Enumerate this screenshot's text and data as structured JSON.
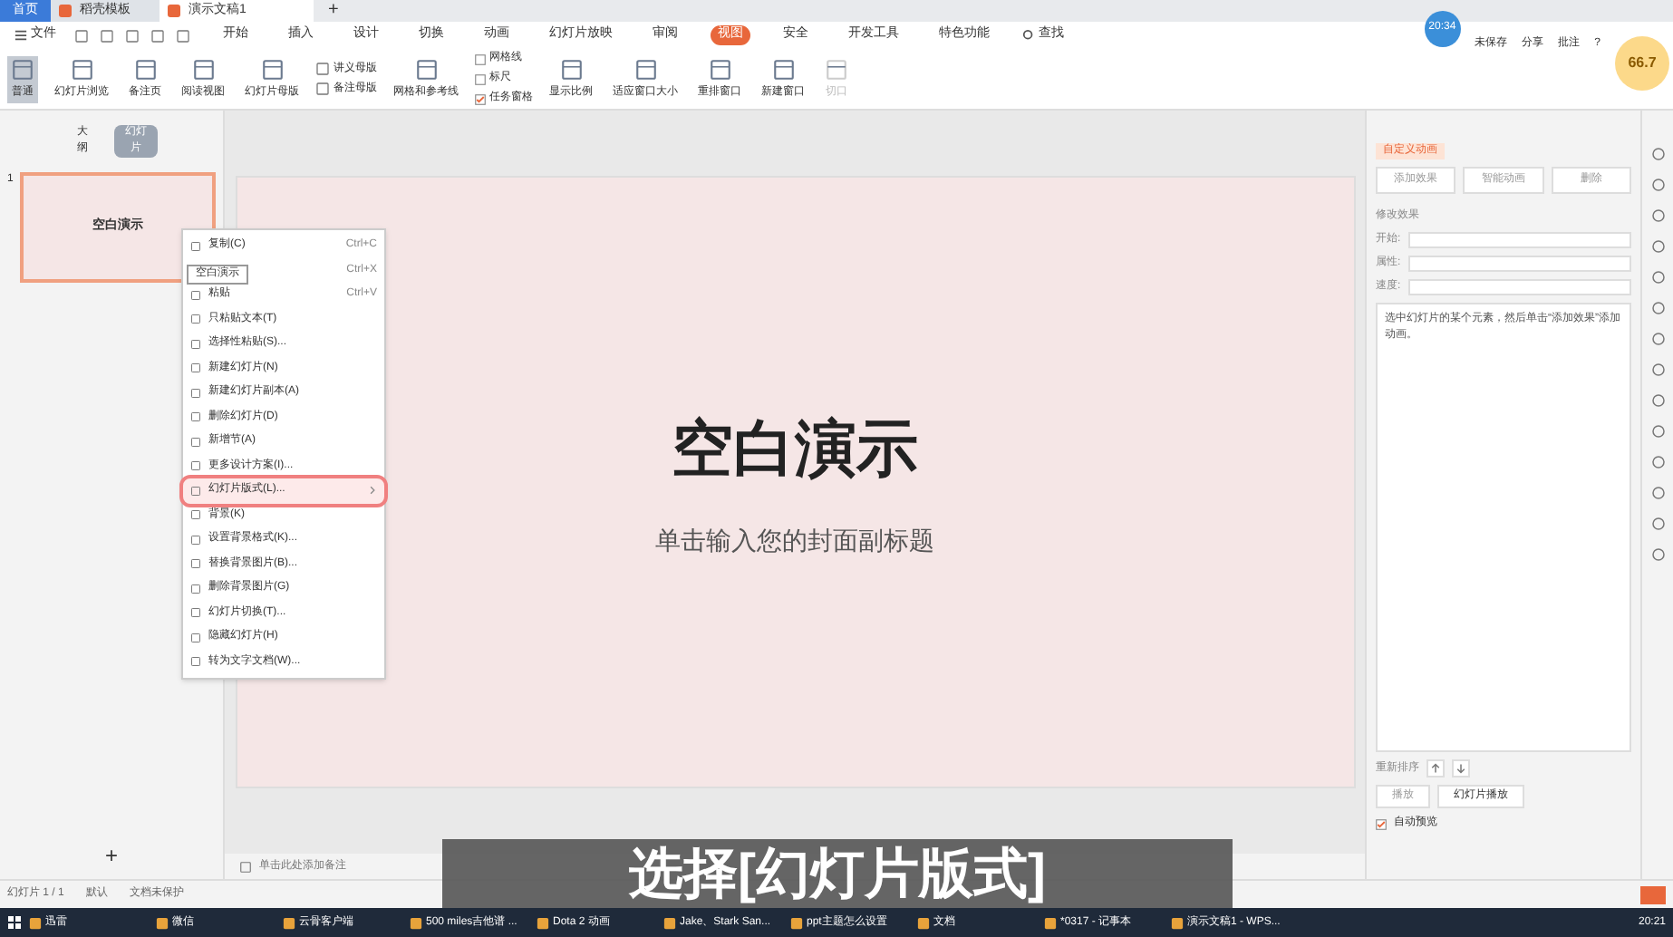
{
  "tabs": [
    {
      "label": "首页",
      "selected": false,
      "kind": "home"
    },
    {
      "label": "稻壳模板",
      "selected": false,
      "kind": "doc"
    },
    {
      "label": "演示文稿1",
      "selected": true,
      "kind": "doc"
    }
  ],
  "new_tab": "+",
  "menu": [
    {
      "label": "文件"
    },
    {
      "label": "开始",
      "selected": false
    },
    {
      "label": "插入",
      "selected": false
    },
    {
      "label": "设计",
      "selected": false
    },
    {
      "label": "切换",
      "selected": false
    },
    {
      "label": "动画",
      "selected": false
    },
    {
      "label": "幻灯片放映",
      "selected": false
    },
    {
      "label": "审阅",
      "selected": false
    },
    {
      "label": "视图",
      "selected": true
    },
    {
      "label": "安全",
      "selected": false
    },
    {
      "label": "开发工具",
      "selected": false
    },
    {
      "label": "特色功能",
      "selected": false
    }
  ],
  "search": {
    "label": "查找"
  },
  "account": {
    "time": "20:34",
    "actions": [
      "未保存",
      "分享",
      "批注",
      "?"
    ],
    "speed": "66.7"
  },
  "ribbon": [
    {
      "label": "普通",
      "kind": "big",
      "selected": true
    },
    {
      "label": "幻灯片浏览",
      "kind": "big",
      "selected": false
    },
    {
      "label": "备注页",
      "kind": "big",
      "selected": false
    },
    {
      "label": "阅读视图",
      "kind": "big",
      "selected": false
    },
    {
      "label": "幻灯片母版",
      "kind": "big",
      "selected": false
    },
    {
      "label": "讲义母版",
      "kind": "small"
    },
    {
      "label": "备注母版",
      "kind": "small"
    },
    {
      "label": "网格和参考线",
      "kind": "big",
      "selected": false
    },
    {
      "label": "网格线",
      "kind": "check",
      "checked": false
    },
    {
      "label": "标尺",
      "kind": "check",
      "checked": false
    },
    {
      "label": "任务窗格",
      "kind": "check",
      "checked": true
    },
    {
      "label": "显示比例",
      "kind": "big",
      "selected": false
    },
    {
      "label": "适应窗口大小",
      "kind": "big",
      "selected": false
    },
    {
      "label": "重排窗口",
      "kind": "big",
      "selected": false
    },
    {
      "label": "新建窗口",
      "kind": "big",
      "selected": false
    },
    {
      "label": "切口",
      "kind": "big",
      "disabled": true
    }
  ],
  "left_panel": {
    "tabs": [
      {
        "label": "大纲",
        "selected": false
      },
      {
        "label": "幻灯片",
        "selected": true
      }
    ],
    "slides": [
      {
        "number": "1",
        "title": "空白演示",
        "selected": true
      }
    ],
    "add": "+"
  },
  "context_menu": {
    "tooltip": "空白演示",
    "items": [
      {
        "label": "复制(C)",
        "shortcut": "Ctrl+C",
        "highlighted": false
      },
      {
        "shortcut": "Ctrl+X",
        "highlighted": false
      },
      {
        "label": "粘贴",
        "shortcut": "Ctrl+V",
        "highlighted": false
      },
      {
        "label": "只粘贴文本(T)",
        "highlighted": false
      },
      {
        "label": "选择性粘贴(S)...",
        "highlighted": false
      },
      {
        "label": "新建幻灯片(N)",
        "highlighted": false
      },
      {
        "label": "新建幻灯片副本(A)",
        "highlighted": false
      },
      {
        "label": "删除幻灯片(D)",
        "highlighted": false
      },
      {
        "label": "新增节(A)",
        "highlighted": false
      },
      {
        "label": "更多设计方案(I)...",
        "highlighted": false
      },
      {
        "label": "幻灯片版式(L)...",
        "highlighted": true,
        "submenu": true
      },
      {
        "label": "背景(K)",
        "highlighted": false
      },
      {
        "label": "设置背景格式(K)...",
        "highlighted": false
      },
      {
        "label": "替换背景图片(B)...",
        "highlighted": false
      },
      {
        "label": "删除背景图片(G)",
        "highlighted": false
      },
      {
        "label": "幻灯片切换(T)...",
        "highlighted": false
      },
      {
        "label": "隐藏幻灯片(H)",
        "highlighted": false
      },
      {
        "label": "转为文字文档(W)...",
        "highlighted": false
      }
    ]
  },
  "slide": {
    "title": "空白演示",
    "subtitle": "单击输入您的封面副标题"
  },
  "notes": {
    "placeholder": "单击此处添加备注"
  },
  "task_pane": {
    "title": "自定义动画",
    "buttons": [
      "添加效果",
      "智能动画",
      "删除"
    ],
    "section": "修改效果",
    "fields": [
      {
        "label": "开始:"
      },
      {
        "label": "属性:"
      },
      {
        "label": "速度:"
      }
    ],
    "hint": "选中幻灯片的某个元素，然后单击“添加效果”添加动画。",
    "reorder": "重新排序",
    "play": "播放",
    "slideshow": "幻灯片播放",
    "autopreview": {
      "label": "自动预览",
      "checked": true
    }
  },
  "status_bar": {
    "slide": "幻灯片 1 / 1",
    "theme": "默认",
    "protect": "文档未保护"
  },
  "caption": "选择[幻灯片版式]",
  "taskbar": [
    {
      "label": "迅雷"
    },
    {
      "label": "微信"
    },
    {
      "label": "云骨客户端"
    },
    {
      "label": "500 miles吉他谱 ..."
    },
    {
      "label": "Dota 2 动画"
    },
    {
      "label": "Jake、Stark San..."
    },
    {
      "label": "ppt主题怎么设置"
    },
    {
      "label": "文档"
    },
    {
      "label": "*0317 - 记事本"
    },
    {
      "label": "演示文稿1 - WPS..."
    }
  ],
  "clock": "20:21"
}
